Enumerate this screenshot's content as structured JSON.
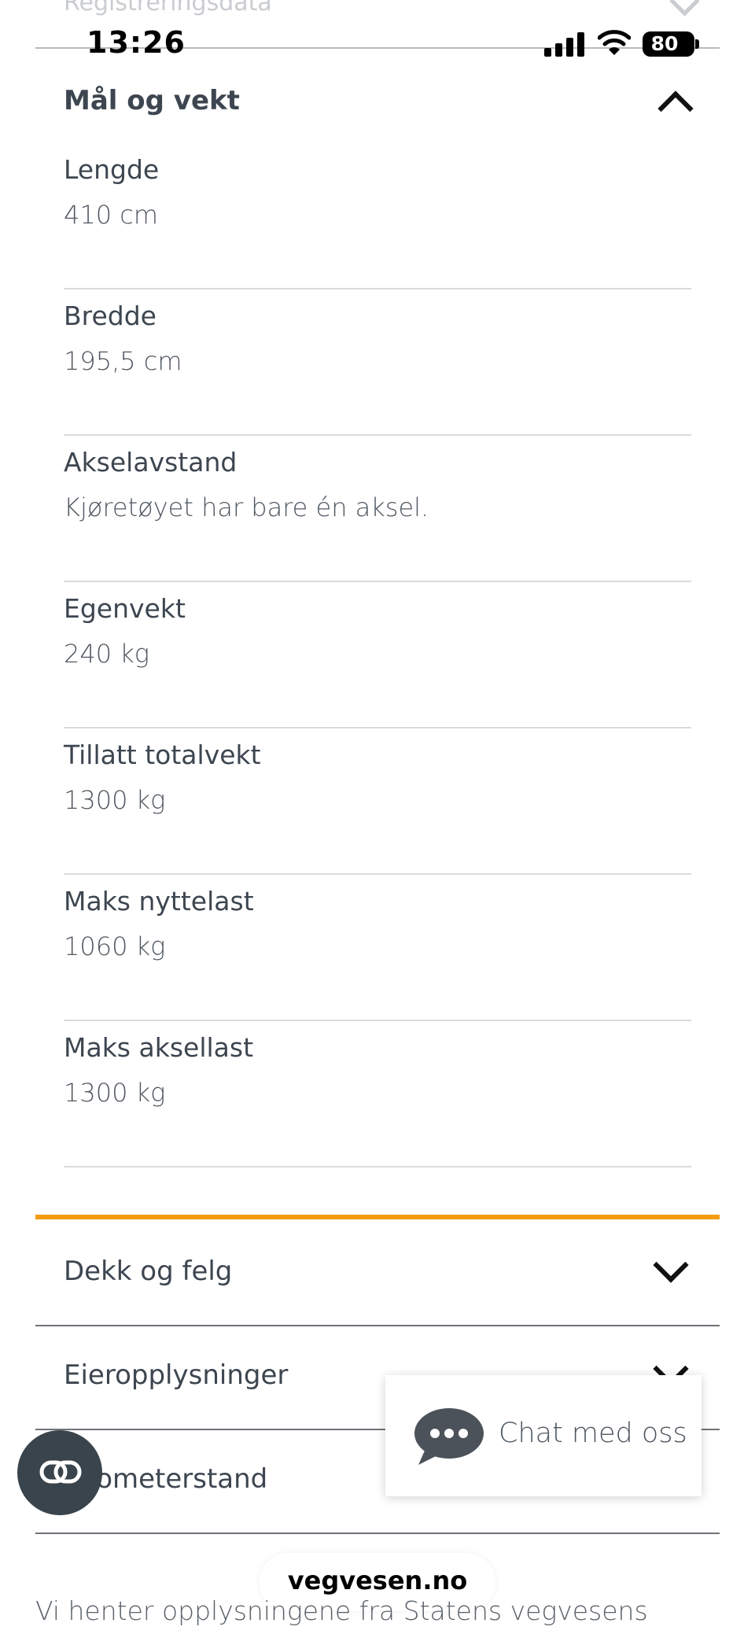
{
  "previous_section": {
    "title": "Registreringsdata"
  },
  "status_bar": {
    "time": "13:26",
    "battery": "80"
  },
  "section": {
    "title": "Mål og vekt",
    "items": [
      {
        "label": "Lengde",
        "value": "410 cm"
      },
      {
        "label": "Bredde",
        "value": "195,5 cm"
      },
      {
        "label": "Akselavstand",
        "value": "Kjøretøyet har bare én aksel."
      },
      {
        "label": "Egenvekt",
        "value": "240 kg"
      },
      {
        "label": "Tillatt totalvekt",
        "value": "1300 kg"
      },
      {
        "label": "Maks nyttelast",
        "value": "1060 kg"
      },
      {
        "label": "Maks aksellast",
        "value": "1300 kg"
      }
    ]
  },
  "accordions": [
    {
      "title": "Dekk og felg"
    },
    {
      "title": "Eieropplysninger"
    },
    {
      "title": "Kilometerstand"
    }
  ],
  "chat": {
    "label": "Chat med oss"
  },
  "browser": {
    "domain": "vegvesen.no"
  },
  "footer": {
    "text": "Vi henter opplysningene fra Statens vegvesens"
  },
  "colors": {
    "accent": "#f39c12",
    "text": "#3d4650",
    "reader_button": "#3a444c"
  }
}
